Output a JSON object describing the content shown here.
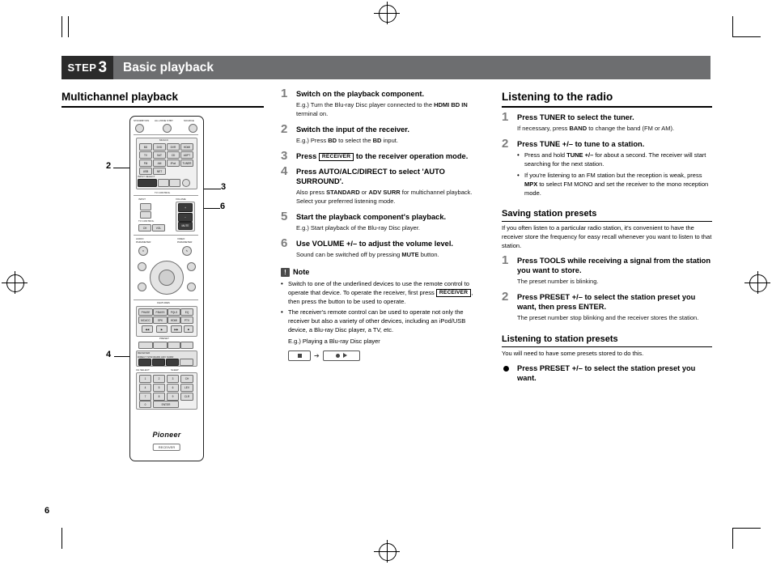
{
  "header": {
    "step_word": "STEP",
    "step_number": "3",
    "title": "Basic playback"
  },
  "page_number": "6",
  "column1": {
    "heading": "Multichannel playback",
    "callouts": [
      "2",
      "3",
      "6",
      "4"
    ],
    "remote": {
      "brand": "Pioneer",
      "model_box": "RECEIVER",
      "top_labels": [
        "STANDBY/ON",
        "ALL ZONE STBY",
        "SOURCE"
      ],
      "input_labels": [
        "BD",
        "DVD",
        "SAT",
        "HDMI",
        "TV",
        "CD",
        "TUNER",
        "ADPT",
        "FM",
        "AM",
        "iPod",
        "USB",
        "NET",
        "TUNE"
      ],
      "section_labels": [
        "TV CONTROL",
        "AUDIO PARAMETER",
        "VIDEO PARAMETER",
        "INPUT SELECT",
        "MUTE",
        "VOLUME",
        "FEATURES",
        "PRESET",
        "TOOLS",
        "BAND",
        "MPX",
        "RECEIVER",
        "DIRECT",
        "STANDARD",
        "ADV SURR",
        "AUTO/ALC"
      ]
    }
  },
  "column2": {
    "steps": [
      {
        "n": "1",
        "title": "Switch on the playback component.",
        "detail_pre": "E.g.) Turn the Blu-ray Disc player connected to the ",
        "detail_b1": "HDMI BD IN",
        "detail_post": " terminal on."
      },
      {
        "n": "2",
        "title": "Switch the input of the receiver.",
        "detail_pre": "E.g.) Press ",
        "detail_b1": "BD",
        "detail_mid": " to select the ",
        "detail_b2": "BD",
        "detail_post": " input."
      },
      {
        "n": "3",
        "title_pre": "Press ",
        "key": "RECEIVER",
        "title_post": " to the receiver operation mode."
      },
      {
        "n": "4",
        "title": "Press AUTO/ALC/DIRECT to select 'AUTO SURROUND'.",
        "detail_pre": "Also press ",
        "detail_b1": "STANDARD",
        "detail_mid": " or ",
        "detail_b2": "ADV SURR",
        "detail_post": " for multichannel playback. Select your preferred listening mode."
      },
      {
        "n": "5",
        "title": "Start the playback component's playback.",
        "detail": "E.g.) Start playback of the Blu-ray Disc player."
      },
      {
        "n": "6",
        "title": "Use VOLUME +/– to adjust the volume level.",
        "detail_pre": "Sound can be switched off by pressing ",
        "detail_b1": "MUTE",
        "detail_post": " button."
      }
    ],
    "note": {
      "icon": "!",
      "title": "Note",
      "items": [
        {
          "pre": "Switch to one of the underlined devices to use the remote control to operate that device. To operate the receiver, first press ",
          "key": "RECEIVER",
          "post": ", then press the button to be used to operate."
        },
        {
          "text": "The receiver's remote control can be used to operate not only the receiver but also a variety of other devices, including an iPod/USB device, a Blu-ray Disc player, a TV, etc."
        }
      ],
      "example": "E.g.) Playing a Blu-ray Disc player"
    }
  },
  "column3": {
    "heading": "Listening to the radio",
    "steps": [
      {
        "n": "1",
        "title": "Press TUNER to select the tuner.",
        "detail_pre": "If necessary, press ",
        "detail_b1": "BAND",
        "detail_post": " to change the band (FM or AM)."
      },
      {
        "n": "2",
        "title": "Press TUNE +/– to tune to a station.",
        "bullets": [
          {
            "pre": "Press and hold ",
            "b": "TUNE +/–",
            "post": " for about a second. The receiver will start searching for the next station."
          },
          {
            "pre": "If you're listening to an FM station but the reception is weak, press ",
            "b": "MPX",
            "post": " to select FM MONO and set the receiver to the mono reception mode."
          }
        ]
      }
    ],
    "presets": {
      "heading": "Saving station presets",
      "intro": "If you often listen to a particular radio station, it's convenient to have the receiver store the frequency for easy recall whenever you want to listen to that station.",
      "steps": [
        {
          "n": "1",
          "title": "Press TOOLS while receiving a signal from the station you want to store.",
          "detail": "The preset number is blinking."
        },
        {
          "n": "2",
          "title": "Press PRESET +/– to select the station preset you want, then press ENTER.",
          "detail": "The preset number stop blinking and the receiver stores the station."
        }
      ]
    },
    "listening_presets": {
      "heading": "Listening to station presets",
      "intro": "You will need to have some presets stored to do this.",
      "bullet_title": "Press PRESET +/– to select the station preset you want."
    }
  }
}
